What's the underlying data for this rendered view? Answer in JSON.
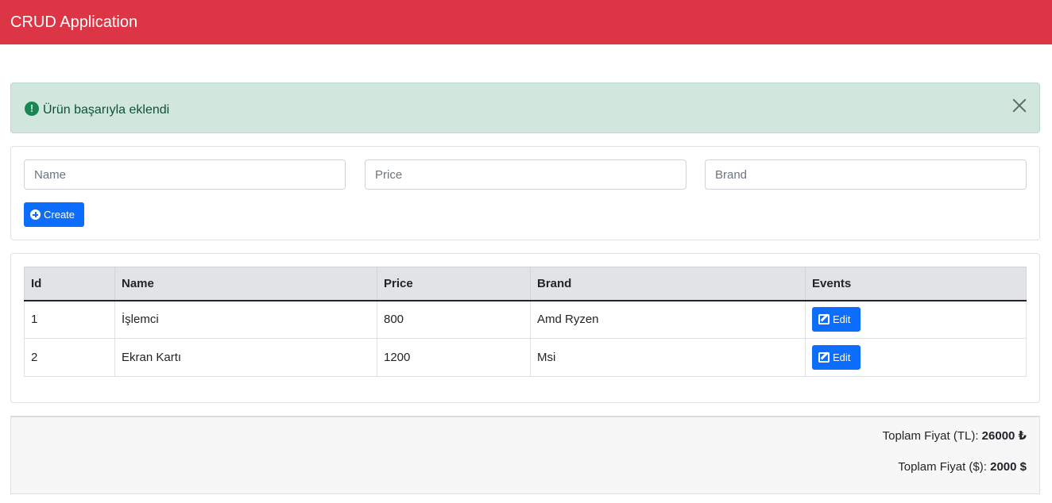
{
  "navbar": {
    "title": "CRUD Application"
  },
  "alert": {
    "icon": "exclamation-circle-icon",
    "message": "Ürün başarıyla eklendi",
    "close_icon": "close-icon"
  },
  "form": {
    "name_placeholder": "Name",
    "price_placeholder": "Price",
    "brand_placeholder": "Brand",
    "create_label": "Create"
  },
  "table": {
    "headers": [
      "Id",
      "Name",
      "Price",
      "Brand",
      "Events"
    ],
    "rows": [
      {
        "id": "1",
        "name": "İşlemci",
        "price": "800",
        "brand": "Amd Ryzen",
        "edit_label": "Edit"
      },
      {
        "id": "2",
        "name": "Ekran Kartı",
        "price": "1200",
        "brand": "Msi",
        "edit_label": "Edit"
      }
    ]
  },
  "totals": {
    "tl_label": "Toplam Fiyat (TL):",
    "tl_value": "26000 ₺",
    "usd_label": "Toplam Fiyat ($):",
    "usd_value": "2000 $"
  },
  "colors": {
    "navbar": "#dc3545",
    "primary": "#0d6efd",
    "alert_bg": "#d1e7dd",
    "alert_icon": "#198754"
  }
}
